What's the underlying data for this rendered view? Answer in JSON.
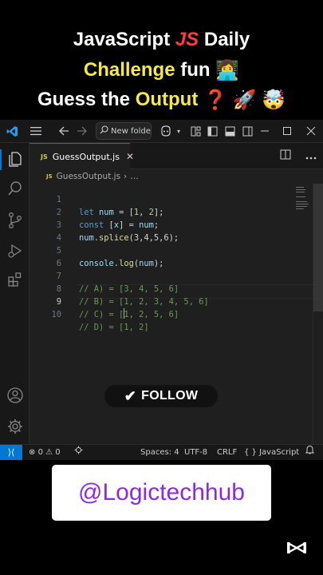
{
  "promo": {
    "line1_a": "JavaScript",
    "line1_js": "JS",
    "line1_b": "Daily",
    "line2_a": "Challenge",
    "line2_b": "fun",
    "line3_a": "Guess the",
    "line3_b": "Output",
    "emoji_technologist": "👩‍💻",
    "emoji_question": "❓",
    "emoji_rocket": "🚀",
    "emoji_exploding_head": "🤯"
  },
  "titlebar": {
    "search_text": "New folder"
  },
  "tab": {
    "js_icon": "JS",
    "filename": "GuessOutput.js",
    "close": "✕"
  },
  "breadcrumb": {
    "file": "GuessOutput.js",
    "more": "…"
  },
  "code": {
    "line_numbers": [
      "1",
      "2",
      "3",
      "4",
      "5",
      "6",
      "7",
      "8",
      "9",
      "10"
    ],
    "l1": {
      "kw": "let",
      "var": "num",
      "eq": " = [",
      "n1": "1",
      "sep": ", ",
      "n2": "2",
      "end": "];"
    },
    "l2": {
      "kw": "const",
      "pre": " [",
      "var": "x",
      "post": "] = ",
      "var2": "num",
      "end": ";"
    },
    "l3": {
      "var": "num",
      "dot": ".",
      "fn": "splice",
      "args": "(3,4,5,6);"
    },
    "l5": {
      "var": "console",
      "dot": ".",
      "fn": "log",
      "open": "(",
      "arg": "num",
      "end": ");"
    },
    "l7": "// A) = [3, 4, 5, 6]",
    "l8": "// B) = [1, 2, 3, 4, 5, 6]",
    "l9_a": "// C) = [",
    "l9_b": "1, 2, 5, 6]",
    "l10": "// D) = [1, 2]"
  },
  "follow_label": "FOLLOW",
  "statusbar": {
    "remote_icon": "⟩⟨",
    "errors": "0",
    "warnings": "0",
    "spaces": "Spaces: 4",
    "encoding": "UTF-8",
    "eol": "CRLF",
    "language_braces": "{ }",
    "language": "JavaScript"
  },
  "handle": "@Logictechhub",
  "colors": {
    "accent_blue": "#0078d4",
    "title_yellow": "#f5e94a",
    "title_red": "#ff3b3b",
    "handle_purple": "#8a2be2"
  }
}
